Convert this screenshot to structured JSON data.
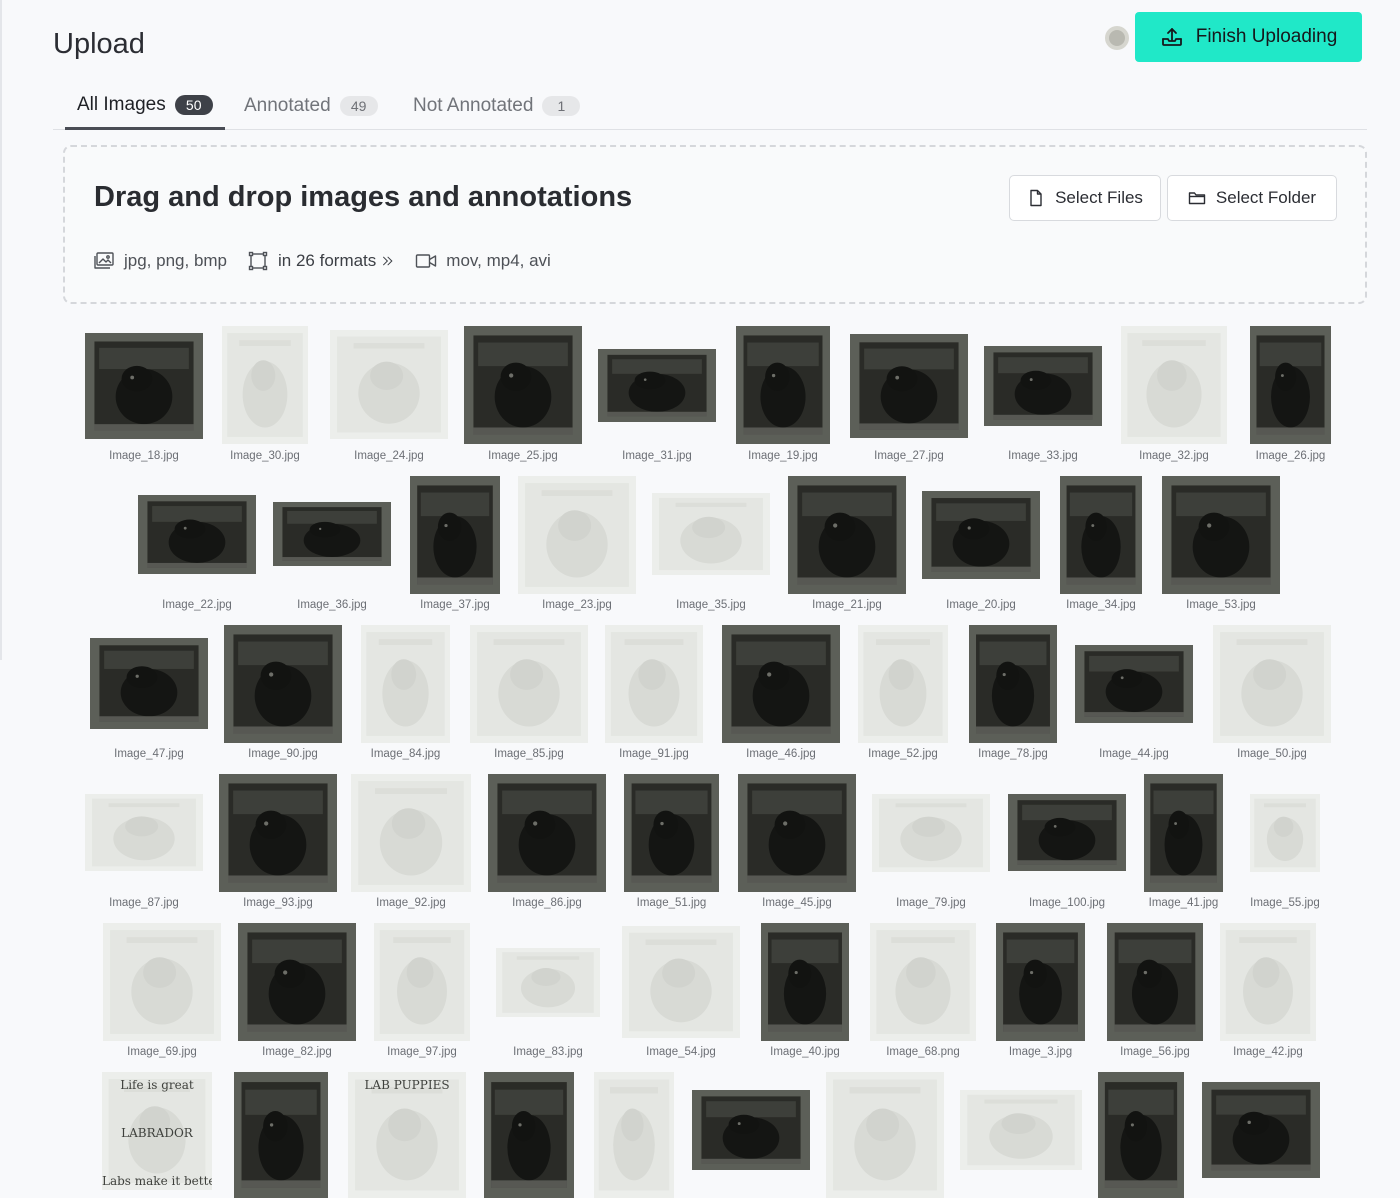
{
  "header": {
    "title": "Upload",
    "finish_button_label": "Finish Uploading",
    "finish_button_color": "#20e8c8"
  },
  "tabs": [
    {
      "label": "All Images",
      "count": "50",
      "active": true
    },
    {
      "label": "Annotated",
      "count": "49",
      "active": false
    },
    {
      "label": "Not Annotated",
      "count": "1",
      "active": false
    }
  ],
  "dropzone": {
    "title": "Drag and drop images and annotations",
    "select_files_label": "Select Files",
    "select_folder_label": "Select Folder",
    "formats": [
      {
        "icon": "images-icon",
        "text": "jpg, png, bmp"
      },
      {
        "icon": "bounding-box-icon",
        "text": "in 26 formats",
        "link": true
      },
      {
        "icon": "video-icon",
        "text": "mov, mp4, avi"
      }
    ]
  },
  "images": [
    {
      "name": "Image_18.jpg",
      "tone": "dark"
    },
    {
      "name": "Image_30.jpg",
      "tone": "light"
    },
    {
      "name": "Image_24.jpg",
      "tone": "light"
    },
    {
      "name": "Image_25.jpg",
      "tone": "dark"
    },
    {
      "name": "Image_31.jpg",
      "tone": "dark"
    },
    {
      "name": "Image_19.jpg",
      "tone": "dark"
    },
    {
      "name": "Image_27.jpg",
      "tone": "dark"
    },
    {
      "name": "Image_33.jpg",
      "tone": "dark"
    },
    {
      "name": "Image_32.jpg",
      "tone": "light"
    },
    {
      "name": "Image_26.jpg",
      "tone": "dark"
    },
    {
      "name": "Image_22.jpg",
      "tone": "dark"
    },
    {
      "name": "Image_36.jpg",
      "tone": "dark"
    },
    {
      "name": "Image_37.jpg",
      "tone": "dark"
    },
    {
      "name": "Image_23.jpg",
      "tone": "light"
    },
    {
      "name": "Image_35.jpg",
      "tone": "light"
    },
    {
      "name": "Image_21.jpg",
      "tone": "dark"
    },
    {
      "name": "Image_20.jpg",
      "tone": "dark"
    },
    {
      "name": "Image_34.jpg",
      "tone": "dark"
    },
    {
      "name": "Image_53.jpg",
      "tone": "dark"
    },
    {
      "name": "Image_47.jpg",
      "tone": "dark"
    },
    {
      "name": "Image_90.jpg",
      "tone": "dark"
    },
    {
      "name": "Image_84.jpg",
      "tone": "light"
    },
    {
      "name": "Image_85.jpg",
      "tone": "light"
    },
    {
      "name": "Image_91.jpg",
      "tone": "light"
    },
    {
      "name": "Image_46.jpg",
      "tone": "dark"
    },
    {
      "name": "Image_52.jpg",
      "tone": "light"
    },
    {
      "name": "Image_78.jpg",
      "tone": "dark"
    },
    {
      "name": "Image_44.jpg",
      "tone": "dark"
    },
    {
      "name": "Image_50.jpg",
      "tone": "light"
    },
    {
      "name": "Image_87.jpg",
      "tone": "light"
    },
    {
      "name": "Image_93.jpg",
      "tone": "dark"
    },
    {
      "name": "Image_92.jpg",
      "tone": "light"
    },
    {
      "name": "Image_86.jpg",
      "tone": "dark"
    },
    {
      "name": "Image_51.jpg",
      "tone": "dark"
    },
    {
      "name": "Image_45.jpg",
      "tone": "dark"
    },
    {
      "name": "Image_79.jpg",
      "tone": "light"
    },
    {
      "name": "Image_100.jpg",
      "tone": "dark"
    },
    {
      "name": "Image_41.jpg",
      "tone": "dark"
    },
    {
      "name": "Image_55.jpg",
      "tone": "light"
    },
    {
      "name": "Image_69.jpg",
      "tone": "light"
    },
    {
      "name": "Image_82.jpg",
      "tone": "dark"
    },
    {
      "name": "Image_97.jpg",
      "tone": "light"
    },
    {
      "name": "Image_83.jpg",
      "tone": "light"
    },
    {
      "name": "Image_54.jpg",
      "tone": "light"
    },
    {
      "name": "Image_40.jpg",
      "tone": "dark"
    },
    {
      "name": "Image_68.png",
      "tone": "light"
    },
    {
      "name": "Image_3.jpg",
      "tone": "dark"
    },
    {
      "name": "Image_56.jpg",
      "tone": "dark"
    },
    {
      "name": "Image_42.jpg",
      "tone": "light"
    },
    {
      "name": "",
      "tone": "light",
      "overlay_text": [
        "Life is great",
        "LABRADOR",
        "Labs make it better."
      ]
    },
    {
      "name": "",
      "tone": "dark"
    },
    {
      "name": "",
      "tone": "light",
      "overlay_text": [
        "LAB PUPPIES"
      ]
    },
    {
      "name": "",
      "tone": "dark"
    },
    {
      "name": "",
      "tone": "light"
    },
    {
      "name": "",
      "tone": "dark"
    },
    {
      "name": "",
      "tone": "light"
    },
    {
      "name": "",
      "tone": "light"
    },
    {
      "name": "",
      "tone": "dark"
    },
    {
      "name": "",
      "tone": "dark"
    }
  ]
}
